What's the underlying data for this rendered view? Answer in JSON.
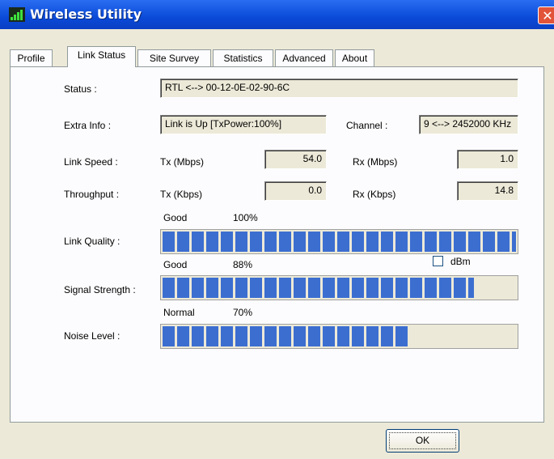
{
  "window": {
    "title": "Wireless Utility",
    "close_glyph": "✕"
  },
  "tabs": [
    {
      "label": "Profile"
    },
    {
      "label": "Link Status"
    },
    {
      "label": "Site Survey"
    },
    {
      "label": "Statistics"
    },
    {
      "label": "Advanced"
    },
    {
      "label": "About"
    }
  ],
  "status": {
    "label": "Status :",
    "value": "RTL <--> 00-12-0E-02-90-6C"
  },
  "extra_info": {
    "label": "Extra Info :",
    "value": "Link is Up [TxPower:100%]"
  },
  "channel": {
    "label": "Channel :",
    "value": "9 <--> 2452000 KHz"
  },
  "link_speed": {
    "label": "Link Speed :",
    "tx_label": "Tx (Mbps)",
    "tx_value": "54.0",
    "rx_label": "Rx (Mbps)",
    "rx_value": "1.0"
  },
  "throughput": {
    "label": "Throughput :",
    "tx_label": "Tx (Kbps)",
    "tx_value": "0.0",
    "rx_label": "Rx (Kbps)",
    "rx_value": "14.8"
  },
  "link_quality": {
    "label": "Link Quality :",
    "rating": "Good",
    "percent_text": "100%",
    "fraction": 1.0
  },
  "signal_strength": {
    "label": "Signal Strength :",
    "rating": "Good",
    "percent_text": "88%",
    "fraction": 0.88
  },
  "noise_level": {
    "label": "Noise Level :",
    "rating": "Normal",
    "percent_text": "70%",
    "fraction": 0.7
  },
  "dbm": {
    "label": "dBm",
    "checked": false
  },
  "footer": {
    "ok_label": "OK"
  },
  "colors": {
    "bar_fill": "#3c6ed0",
    "titlebar": "#0a4ad8"
  }
}
